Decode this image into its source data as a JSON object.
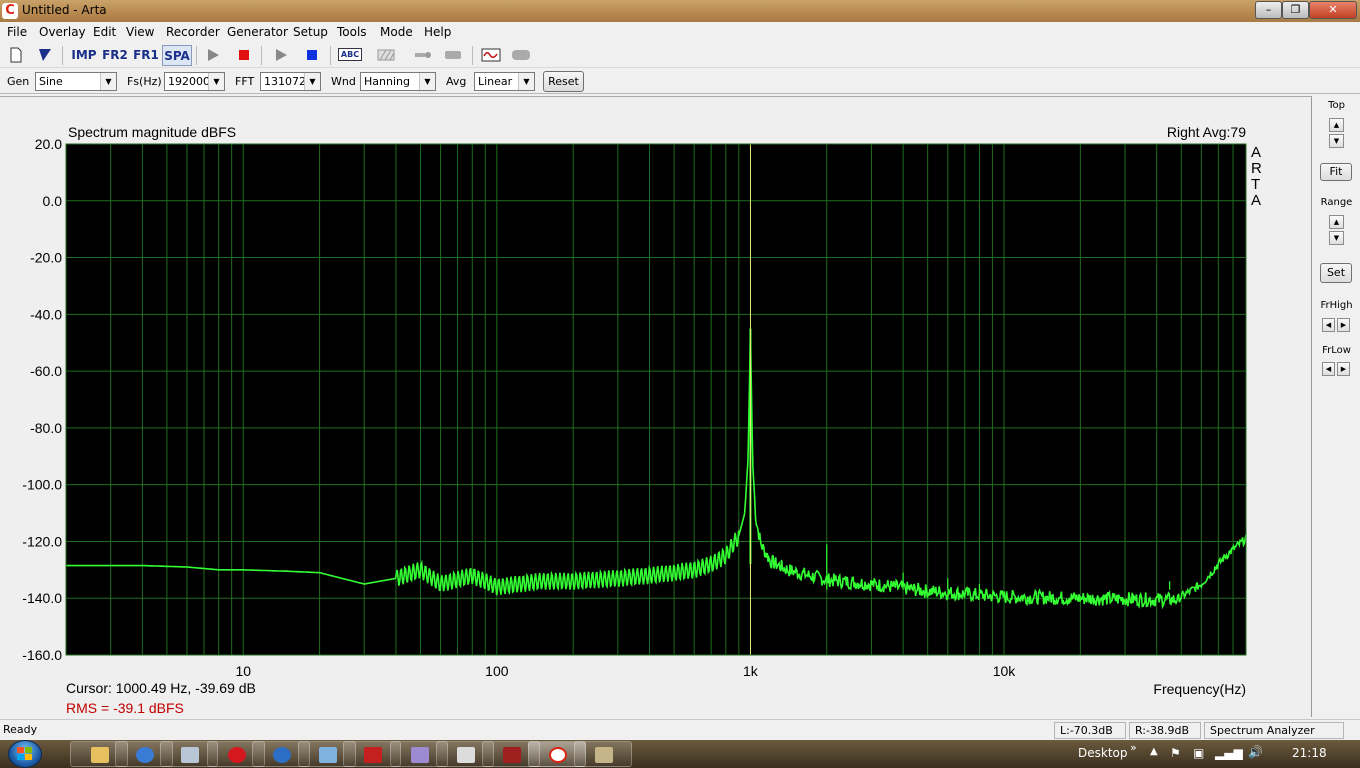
{
  "window": {
    "title": "Untitled - Arta",
    "app_icon": "arta-app-icon",
    "controls": [
      "minimize",
      "maximize",
      "close"
    ]
  },
  "menu": [
    "File",
    "Overlay",
    "Edit",
    "View",
    "Recorder",
    "Generator",
    "Setup",
    "Tools",
    "Mode",
    "Help"
  ],
  "toolbar": {
    "imp": "IMP",
    "fr2": "FR2",
    "fr1": "FR1",
    "spa": "SPA",
    "abc": "ABC"
  },
  "controls": {
    "gen_label": "Gen",
    "gen_value": "Sine",
    "fs_label": "Fs(Hz)",
    "fs_value": "192000",
    "fft_label": "FFT",
    "fft_value": "131072",
    "wnd_label": "Wnd",
    "wnd_value": "Hanning",
    "avg_label": "Avg",
    "avg_value": "Linear",
    "reset_label": "Reset"
  },
  "chart": {
    "title": "Spectrum magnitude dBFS",
    "channel_info": "Right  Avg:79",
    "watermark": [
      "A",
      "R",
      "T",
      "A"
    ],
    "cursor": "Cursor: 1000.49 Hz, -39.69 dB",
    "rms": "RMS =  -39.1 dBFS",
    "xlabel": "Frequency(Hz)"
  },
  "chart_data": {
    "type": "line",
    "title": "Spectrum magnitude dBFS",
    "xlabel": "Frequency(Hz)",
    "ylabel": "",
    "xscale": "log",
    "xlim": [
      2,
      90000
    ],
    "ylim": [
      -160,
      20
    ],
    "grid": true,
    "xticks": [
      "10",
      "100",
      "1k",
      "10k"
    ],
    "yticks": [
      "20.0",
      "0.0",
      "-20.0",
      "-40.0",
      "-60.0",
      "-80.0",
      "-100.0",
      "-120.0",
      "-140.0",
      "-160.0"
    ],
    "cursor_hz": 1000.49,
    "series": [
      {
        "x": [
          2,
          4,
          6,
          8,
          10,
          15,
          20,
          30,
          40,
          50,
          60,
          80,
          100,
          150,
          200,
          300,
          400,
          500,
          600,
          700,
          800,
          900,
          950,
          980,
          1000,
          1020,
          1050,
          1100,
          1200,
          1400,
          1700,
          2000,
          3000,
          5000,
          10000,
          20000,
          40000,
          48000,
          60000,
          75000,
          90000
        ],
        "y": [
          -128.5,
          -128.5,
          -129,
          -130,
          -130,
          -130.5,
          -131,
          -135,
          -133,
          -130,
          -135,
          -132,
          -136,
          -134,
          -134,
          -133,
          -132,
          -131,
          -130,
          -128,
          -125,
          -118,
          -110,
          -90,
          -45,
          -92,
          -112,
          -121,
          -127,
          -130,
          -132,
          -133.5,
          -135,
          -137.5,
          -139.5,
          -140,
          -140.5,
          -140.5,
          -135,
          -125,
          -119
        ]
      }
    ],
    "spurs": [
      {
        "x": 2000,
        "y": -121
      },
      {
        "x": 4000,
        "y": -131
      },
      {
        "x": 6000,
        "y": -133
      },
      {
        "x": 8000,
        "y": -135
      },
      {
        "x": 45000,
        "y": -134
      }
    ],
    "colors": {
      "trace": "#33ff33",
      "grid": "#1f6e1f",
      "background": "#000000",
      "cursor": "#e0e060"
    }
  },
  "right_panel": {
    "top_label": "Top",
    "fit_label": "Fit",
    "range_label": "Range",
    "set_label": "Set",
    "frhigh_label": "FrHigh",
    "frlow_label": "FrLow"
  },
  "status": {
    "ready": "Ready",
    "left_level": "L:-70.3dB",
    "right_level": "R:-38.9dB",
    "mode": "Spectrum Analyzer"
  },
  "taskbar": {
    "desktop_label": "Desktop",
    "chevron": "»",
    "time": "21:18",
    "apps": [
      "file-explorer",
      "browser",
      "calculator",
      "opera",
      "network-app",
      "window-app",
      "pdf-reader",
      "media-app",
      "document-app",
      "recorder-app",
      "arta-app",
      "utility-app"
    ]
  }
}
